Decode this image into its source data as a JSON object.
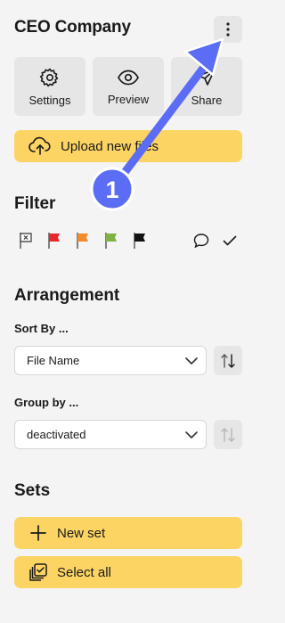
{
  "header": {
    "title": "CEO Company"
  },
  "tiles": [
    {
      "label": "Settings",
      "icon": "gear-icon"
    },
    {
      "label": "Preview",
      "icon": "eye-icon"
    },
    {
      "label": "Share",
      "icon": "send-icon"
    }
  ],
  "upload": {
    "label": "Upload new files"
  },
  "filter": {
    "title": "Filter",
    "flags": [
      {
        "name": "no-flag",
        "color": "#ffffff"
      },
      {
        "name": "red",
        "color": "#e8292b"
      },
      {
        "name": "orange",
        "color": "#f28a2e"
      },
      {
        "name": "green",
        "color": "#7cb342"
      },
      {
        "name": "black",
        "color": "#111111"
      }
    ]
  },
  "arrangement": {
    "title": "Arrangement",
    "sort_label": "Sort By ...",
    "sort_value": "File Name",
    "group_label": "Group by ...",
    "group_value": "deactivated"
  },
  "sets": {
    "title": "Sets",
    "new_set_label": "New set",
    "select_all_label": "Select all"
  },
  "annotation": {
    "number": "1"
  },
  "colors": {
    "accent_yellow": "#fcd464",
    "annotation_blue": "#5b6cf5"
  }
}
